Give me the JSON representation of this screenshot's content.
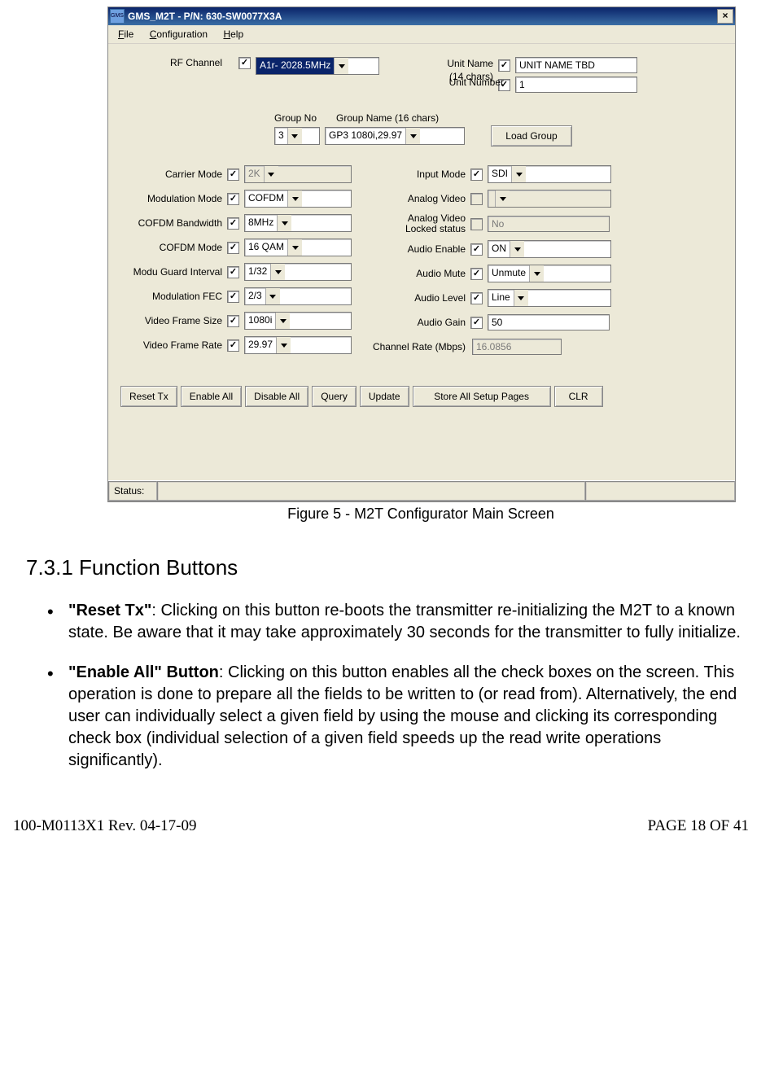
{
  "titlebar": {
    "text": "GMS_M2T - P/N: 630-SW0077X3A"
  },
  "menus": {
    "file": "File",
    "config": "Configuration",
    "help": "Help"
  },
  "rf": {
    "label": "RF Channel",
    "value": "A1r-  2028.5MHz"
  },
  "unit": {
    "name_label": "Unit Name\n(14 chars)",
    "name_lbl1": "Unit Name",
    "name_lbl2": "(14 chars)",
    "name_value": "UNIT NAME TBD",
    "number_label": "Unit Number",
    "number_value": "1"
  },
  "group": {
    "no_label": "Group No",
    "name_label": "Group Name (16 chars)",
    "no_value": "3",
    "name_value": "GP3 1080i,29.97",
    "load_btn": "Load Group"
  },
  "left": {
    "carrier_mode": {
      "label": "Carrier Mode",
      "value": "2K"
    },
    "modulation_mode": {
      "label": "Modulation Mode",
      "value": "COFDM"
    },
    "cofdm_bw": {
      "label": "COFDM Bandwidth",
      "value": "8MHz"
    },
    "cofdm_mode": {
      "label": "COFDM Mode",
      "value": "16 QAM"
    },
    "guard": {
      "label": "Modu Guard Interval",
      "value": "1/32"
    },
    "fec": {
      "label": "Modulation FEC",
      "value": "2/3"
    },
    "vfs": {
      "label": "Video Frame Size",
      "value": "1080i"
    },
    "vfr": {
      "label": "Video Frame Rate",
      "value": "29.97"
    }
  },
  "right": {
    "input_mode": {
      "label": "Input Mode",
      "value": "SDI"
    },
    "analog_video": {
      "label": "Analog Video",
      "value": ""
    },
    "analog_locked": {
      "label": "Analog Video\nLocked status",
      "label1": "Analog Video",
      "label2": "Locked status",
      "value": "No"
    },
    "audio_enable": {
      "label": "Audio Enable",
      "value": "ON"
    },
    "audio_mute": {
      "label": "Audio Mute",
      "value": "Unmute"
    },
    "audio_level": {
      "label": "Audio Level",
      "value": "Line"
    },
    "audio_gain": {
      "label": "Audio Gain",
      "value": "50"
    },
    "channel_rate": {
      "label": "Channel Rate (Mbps)",
      "value": "16.0856"
    }
  },
  "buttons": {
    "reset": "Reset Tx",
    "enable": "Enable All",
    "disable": "Disable All",
    "query": "Query",
    "update": "Update",
    "store": "Store All Setup Pages",
    "clr": "CLR"
  },
  "status": {
    "label": "Status:"
  },
  "caption": "Figure 5 - M2T Configurator Main Screen",
  "doc": {
    "heading": "7.3.1 Function Buttons",
    "b1_title": "\"Reset Tx\"",
    "b1_text": ":  Clicking on this button re-boots the transmitter re-initializing the M2T to a known state. Be aware that it may take approximately 30 seconds for the transmitter to fully initialize.",
    "b2_title": "\"Enable All\" Button",
    "b2_text": ":  Clicking on this button enables all the check boxes on the screen.  This operation is done to prepare all the fields to be written to (or read from).  Alternatively, the end user can individually select a given field by using the mouse and clicking its corresponding check box (individual selection of a given field speeds up the read write operations significantly)."
  },
  "footer": {
    "left": "100-M0113X1 Rev. 04-17-09",
    "right": "PAGE 18 OF 41"
  }
}
